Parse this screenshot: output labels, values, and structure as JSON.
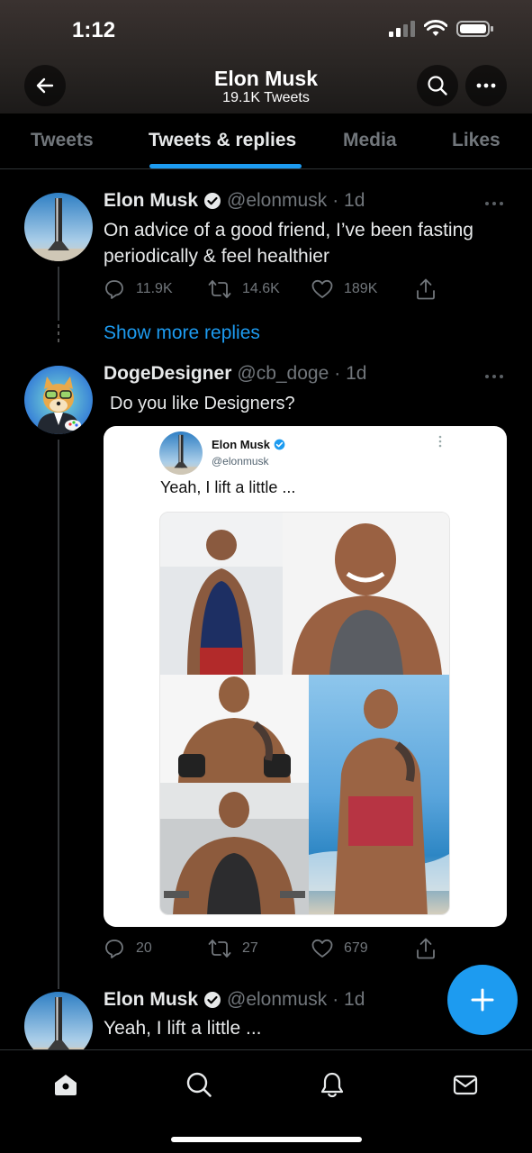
{
  "status": {
    "time": "1:12"
  },
  "header": {
    "title": "Elon Musk",
    "subtitle": "19.1K Tweets"
  },
  "tabs": [
    {
      "label": "Tweets"
    },
    {
      "label": "Tweets & replies",
      "active": true
    },
    {
      "label": "Media"
    },
    {
      "label": "Likes"
    }
  ],
  "tweets": [
    {
      "name": "Elon Musk",
      "verified": true,
      "handle": "@elonmusk",
      "time": "· 1d",
      "text": "On advice of a good friend, I’ve been fasting periodically & feel healthier",
      "replies": "11.9K",
      "retweets": "14.6K",
      "likes": "189K"
    },
    {
      "name": "DogeDesigner",
      "verified": false,
      "handle": "@cb_doge",
      "time": "· 1d",
      "text": "Do you like Designers?",
      "replies": "20",
      "retweets": "27",
      "likes": "679",
      "embed": {
        "name": "Elon Musk",
        "handle": "@elonmusk",
        "text": "Yeah, I lift a little ..."
      }
    },
    {
      "name": "Elon Musk",
      "verified": true,
      "handle": "@elonmusk",
      "time": "· 1d",
      "text": "Yeah, I lift a little ..."
    }
  ],
  "show_more": "Show more replies",
  "icons": {
    "back": "arrow-left-icon",
    "search": "search-icon",
    "more": "more-icon",
    "reply": "reply-icon",
    "retweet": "retweet-icon",
    "like": "heart-icon",
    "share": "share-icon",
    "compose": "plus-icon",
    "home": "home-icon",
    "explore": "search-icon",
    "notifications": "bell-icon",
    "messages": "mail-icon"
  },
  "colors": {
    "accent": "#1d9bf0",
    "background": "#000000",
    "muted": "#71767b"
  }
}
